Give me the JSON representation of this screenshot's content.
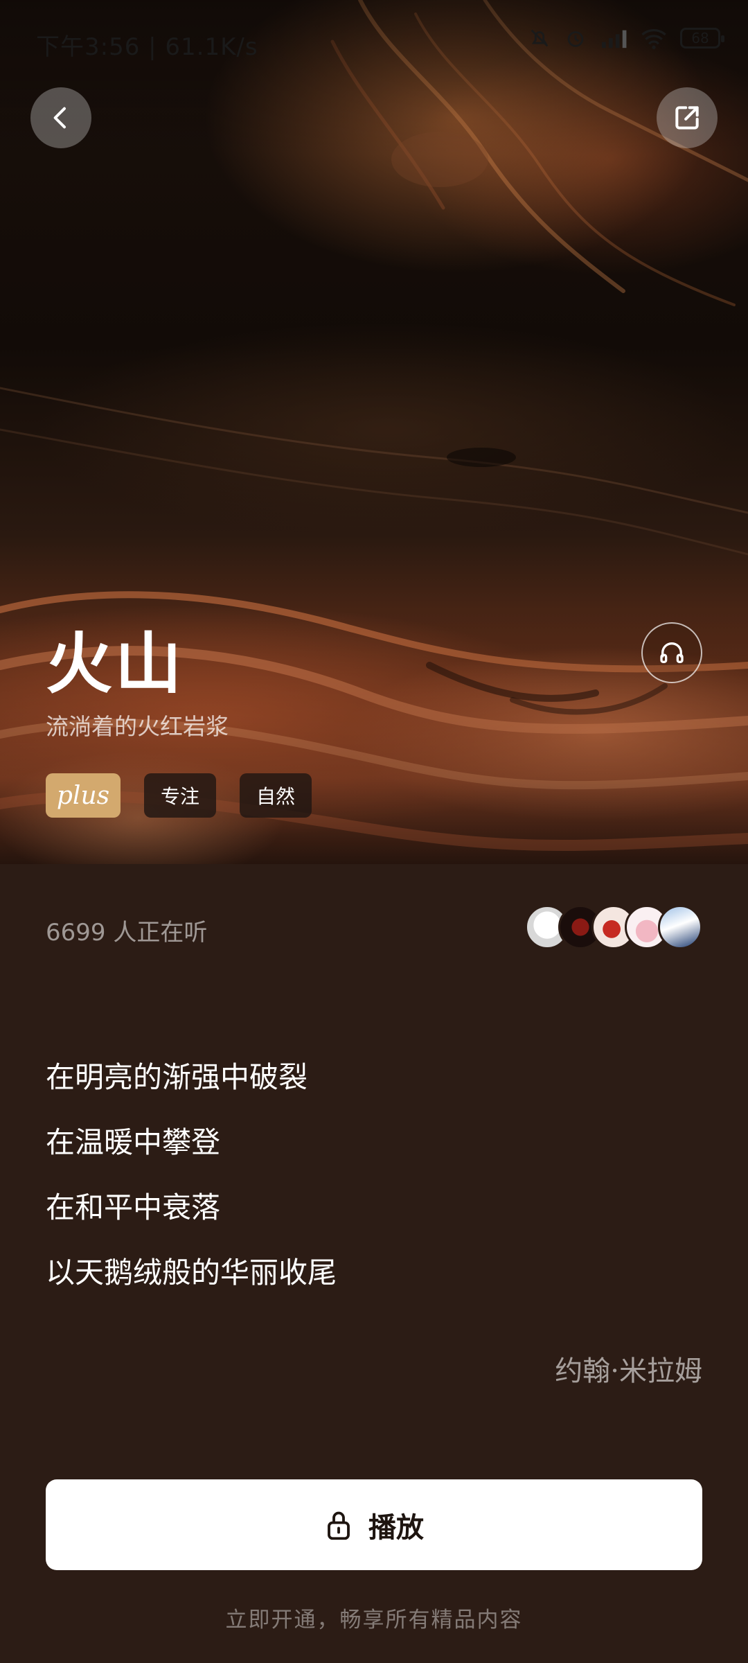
{
  "status_bar": {
    "time": "下午3:56 | 61.1K/s",
    "battery": "68",
    "icons": [
      "mute-icon",
      "alarm-icon",
      "signal-icon",
      "wifi-icon",
      "battery-icon"
    ]
  },
  "nav": {
    "back_icon": "chevron-left-icon",
    "share_icon": "share-icon"
  },
  "hero": {
    "title": "火山",
    "subtitle": "流淌着的火红岩浆",
    "listen_icon": "headphones-icon",
    "tags": [
      {
        "label": "plus"
      },
      {
        "label": "专注"
      },
      {
        "label": "自然"
      }
    ]
  },
  "listeners": {
    "text": "6699 人正在听",
    "avatar_count": 5
  },
  "poem": {
    "lines": [
      "在明亮的渐强中破裂",
      "在温暖中攀登",
      "在和平中衰落",
      "以天鹅绒般的华丽收尾"
    ],
    "author": "约翰·米拉姆"
  },
  "play": {
    "label": "播放",
    "icon": "lock-icon"
  },
  "upsell": {
    "text": "立即开通，畅享所有精品内容"
  },
  "colors": {
    "background": "#2c1c15",
    "plus_badge": "#d3a96e",
    "play_button": "#ffffff"
  }
}
